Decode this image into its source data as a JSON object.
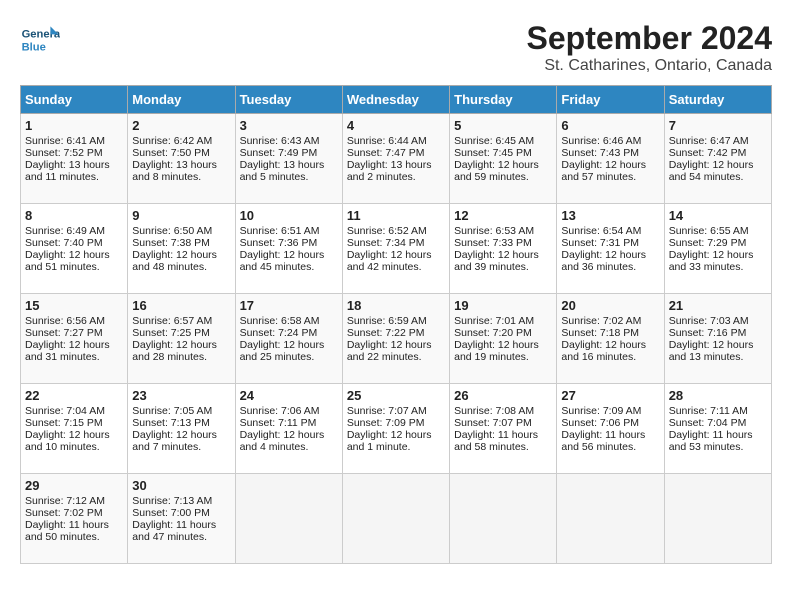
{
  "header": {
    "logo": {
      "general": "General",
      "blue": "Blue"
    },
    "title": "September 2024",
    "subtitle": "St. Catharines, Ontario, Canada"
  },
  "days_of_week": [
    "Sunday",
    "Monday",
    "Tuesday",
    "Wednesday",
    "Thursday",
    "Friday",
    "Saturday"
  ],
  "weeks": [
    [
      {
        "day": "1",
        "sunrise": "6:41 AM",
        "sunset": "7:52 PM",
        "daylight": "13 hours and 11 minutes."
      },
      {
        "day": "2",
        "sunrise": "6:42 AM",
        "sunset": "7:50 PM",
        "daylight": "13 hours and 8 minutes."
      },
      {
        "day": "3",
        "sunrise": "6:43 AM",
        "sunset": "7:49 PM",
        "daylight": "13 hours and 5 minutes."
      },
      {
        "day": "4",
        "sunrise": "6:44 AM",
        "sunset": "7:47 PM",
        "daylight": "13 hours and 2 minutes."
      },
      {
        "day": "5",
        "sunrise": "6:45 AM",
        "sunset": "7:45 PM",
        "daylight": "12 hours and 59 minutes."
      },
      {
        "day": "6",
        "sunrise": "6:46 AM",
        "sunset": "7:43 PM",
        "daylight": "12 hours and 57 minutes."
      },
      {
        "day": "7",
        "sunrise": "6:47 AM",
        "sunset": "7:42 PM",
        "daylight": "12 hours and 54 minutes."
      }
    ],
    [
      {
        "day": "8",
        "sunrise": "6:49 AM",
        "sunset": "7:40 PM",
        "daylight": "12 hours and 51 minutes."
      },
      {
        "day": "9",
        "sunrise": "6:50 AM",
        "sunset": "7:38 PM",
        "daylight": "12 hours and 48 minutes."
      },
      {
        "day": "10",
        "sunrise": "6:51 AM",
        "sunset": "7:36 PM",
        "daylight": "12 hours and 45 minutes."
      },
      {
        "day": "11",
        "sunrise": "6:52 AM",
        "sunset": "7:34 PM",
        "daylight": "12 hours and 42 minutes."
      },
      {
        "day": "12",
        "sunrise": "6:53 AM",
        "sunset": "7:33 PM",
        "daylight": "12 hours and 39 minutes."
      },
      {
        "day": "13",
        "sunrise": "6:54 AM",
        "sunset": "7:31 PM",
        "daylight": "12 hours and 36 minutes."
      },
      {
        "day": "14",
        "sunrise": "6:55 AM",
        "sunset": "7:29 PM",
        "daylight": "12 hours and 33 minutes."
      }
    ],
    [
      {
        "day": "15",
        "sunrise": "6:56 AM",
        "sunset": "7:27 PM",
        "daylight": "12 hours and 31 minutes."
      },
      {
        "day": "16",
        "sunrise": "6:57 AM",
        "sunset": "7:25 PM",
        "daylight": "12 hours and 28 minutes."
      },
      {
        "day": "17",
        "sunrise": "6:58 AM",
        "sunset": "7:24 PM",
        "daylight": "12 hours and 25 minutes."
      },
      {
        "day": "18",
        "sunrise": "6:59 AM",
        "sunset": "7:22 PM",
        "daylight": "12 hours and 22 minutes."
      },
      {
        "day": "19",
        "sunrise": "7:01 AM",
        "sunset": "7:20 PM",
        "daylight": "12 hours and 19 minutes."
      },
      {
        "day": "20",
        "sunrise": "7:02 AM",
        "sunset": "7:18 PM",
        "daylight": "12 hours and 16 minutes."
      },
      {
        "day": "21",
        "sunrise": "7:03 AM",
        "sunset": "7:16 PM",
        "daylight": "12 hours and 13 minutes."
      }
    ],
    [
      {
        "day": "22",
        "sunrise": "7:04 AM",
        "sunset": "7:15 PM",
        "daylight": "12 hours and 10 minutes."
      },
      {
        "day": "23",
        "sunrise": "7:05 AM",
        "sunset": "7:13 PM",
        "daylight": "12 hours and 7 minutes."
      },
      {
        "day": "24",
        "sunrise": "7:06 AM",
        "sunset": "7:11 PM",
        "daylight": "12 hours and 4 minutes."
      },
      {
        "day": "25",
        "sunrise": "7:07 AM",
        "sunset": "7:09 PM",
        "daylight": "12 hours and 1 minute."
      },
      {
        "day": "26",
        "sunrise": "7:08 AM",
        "sunset": "7:07 PM",
        "daylight": "11 hours and 58 minutes."
      },
      {
        "day": "27",
        "sunrise": "7:09 AM",
        "sunset": "7:06 PM",
        "daylight": "11 hours and 56 minutes."
      },
      {
        "day": "28",
        "sunrise": "7:11 AM",
        "sunset": "7:04 PM",
        "daylight": "11 hours and 53 minutes."
      }
    ],
    [
      {
        "day": "29",
        "sunrise": "7:12 AM",
        "sunset": "7:02 PM",
        "daylight": "11 hours and 50 minutes."
      },
      {
        "day": "30",
        "sunrise": "7:13 AM",
        "sunset": "7:00 PM",
        "daylight": "11 hours and 47 minutes."
      },
      {
        "day": "",
        "sunrise": "",
        "sunset": "",
        "daylight": ""
      },
      {
        "day": "",
        "sunrise": "",
        "sunset": "",
        "daylight": ""
      },
      {
        "day": "",
        "sunrise": "",
        "sunset": "",
        "daylight": ""
      },
      {
        "day": "",
        "sunrise": "",
        "sunset": "",
        "daylight": ""
      },
      {
        "day": "",
        "sunrise": "",
        "sunset": "",
        "daylight": ""
      }
    ]
  ]
}
